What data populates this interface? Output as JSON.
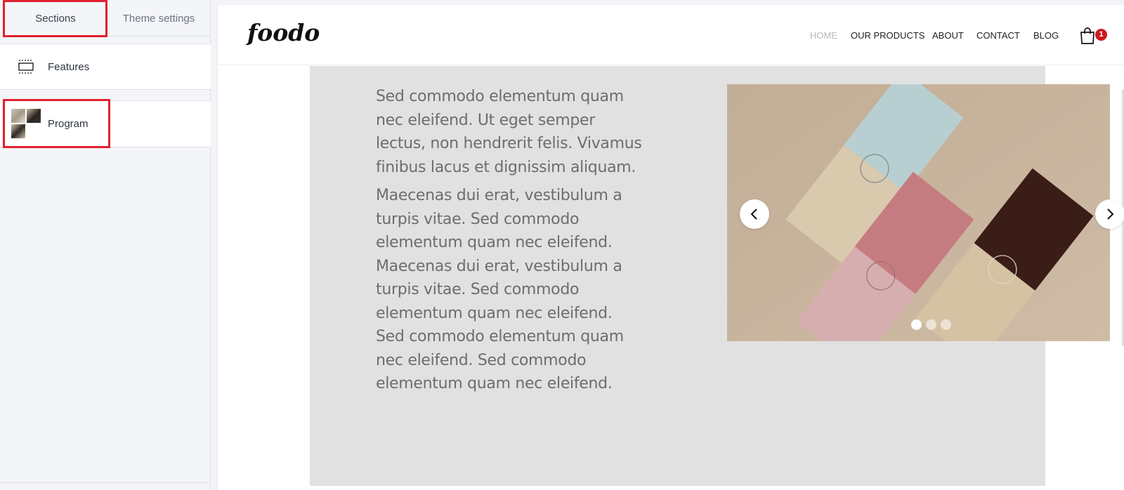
{
  "sidebar": {
    "tabs": [
      {
        "label": "Sections"
      },
      {
        "label": "Theme settings"
      }
    ],
    "items": [
      {
        "label": "Features",
        "icon": "section-layout-icon"
      },
      {
        "label": "Program",
        "icon": "image-thumbnails-icon"
      }
    ]
  },
  "preview": {
    "logo": "foodo",
    "nav": [
      "HOME",
      "OUR PRODUCTS",
      "ABOUT",
      "CONTACT",
      "BLOG"
    ],
    "cart": {
      "icon": "shopping-bag-icon",
      "count": "1"
    },
    "paragraphs": [
      "Sed commodo elementum quam nec eleifend. Ut eget semper lectus, non hendrerit felis. Vivamus finibus lacus et dignissim aliquam.",
      "Maecenas dui erat, vestibulum a turpis vitae. Sed commodo elementum quam nec eleifend. Maecenas dui erat, vestibulum a turpis vitae. Sed commodo elementum quam nec eleifend. Sed commodo elementum quam nec eleifend. Sed commodo elementum quam nec eleifend."
    ],
    "slider": {
      "prev_icon": "chevron-left-icon",
      "next_icon": "chevron-right-icon",
      "slide_count": 3,
      "active_slide": 1
    }
  },
  "colors": {
    "highlight": "#e0212e",
    "badge": "#cc1a1f",
    "content_bg": "#e1e1e1",
    "nav_active": "#b9b9b9"
  }
}
